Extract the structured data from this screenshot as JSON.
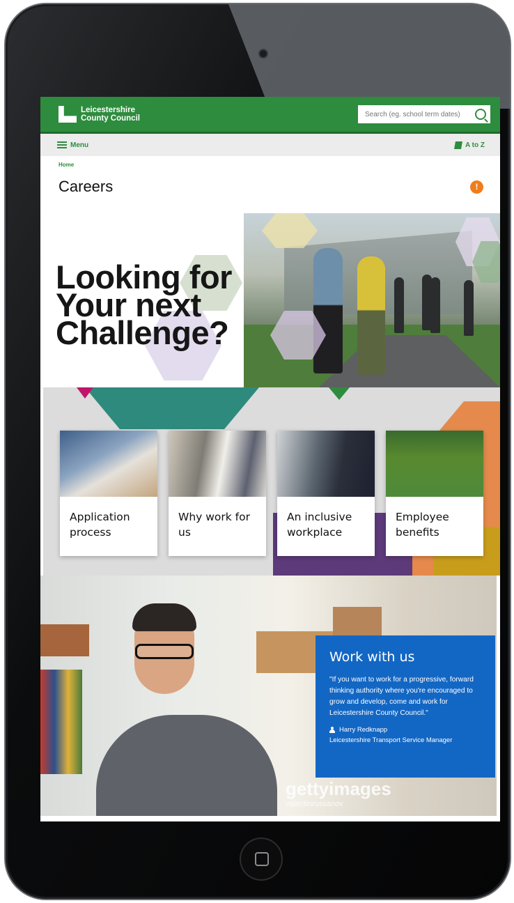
{
  "header": {
    "logo_line1": "Leicestershire",
    "logo_line2": "County Council",
    "search_placeholder": "Search (eg. school term dates)"
  },
  "nav": {
    "menu_label": "Menu",
    "atoz_label": "A to Z"
  },
  "breadcrumb": {
    "home": "Home"
  },
  "page": {
    "title": "Careers",
    "info_icon": "!"
  },
  "hero": {
    "line1": "Looking for",
    "line2": "Your next",
    "line3": "Challenge?"
  },
  "cards": [
    {
      "title": "Application process"
    },
    {
      "title": "Why work for us"
    },
    {
      "title": "An inclusive workplace"
    },
    {
      "title": "Employee benefits"
    }
  ],
  "work": {
    "title": "Work with us",
    "quote": "\"If you want to work for a progressive, forward thinking authority where you're encouraged to grow and develop, come and work for Leicestershire County Council.\"",
    "author": "Harry Redknapp",
    "role": "Leicestershire Transport Service Manager",
    "watermark": "gettyimages",
    "watermark_sub": "valentinrussanov"
  },
  "colors": {
    "brand_green": "#2e8c3e",
    "quote_blue": "#1367c4",
    "info_orange": "#f07d1a"
  }
}
